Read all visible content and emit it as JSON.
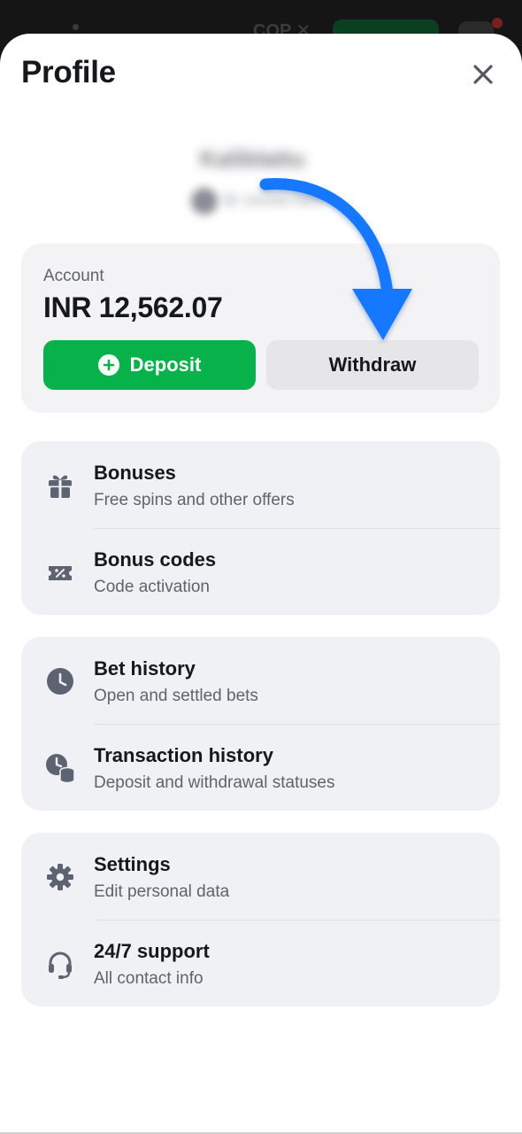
{
  "backdrop": {
    "currency": "COP ✕"
  },
  "profile": {
    "title": "Profile",
    "username": "Kaliblattu",
    "user_id": "ID 142567893"
  },
  "account": {
    "label": "Account",
    "balance": "INR 12,562.07",
    "deposit_label": "Deposit",
    "withdraw_label": "Withdraw"
  },
  "groups": [
    {
      "items": [
        {
          "icon": "gift-icon",
          "title": "Bonuses",
          "subtitle": "Free spins and other offers"
        },
        {
          "icon": "coupon-icon",
          "title": "Bonus codes",
          "subtitle": "Code activation"
        }
      ]
    },
    {
      "items": [
        {
          "icon": "clock-icon",
          "title": "Bet history",
          "subtitle": "Open and settled bets"
        },
        {
          "icon": "clock-coins-icon",
          "title": "Transaction history",
          "subtitle": "Deposit and withdrawal statuses"
        }
      ]
    },
    {
      "items": [
        {
          "icon": "gear-icon",
          "title": "Settings",
          "subtitle": "Edit personal data"
        },
        {
          "icon": "headset-icon",
          "title": "24/7 support",
          "subtitle": "All contact info"
        }
      ]
    }
  ],
  "colors": {
    "deposit": "#07b24b",
    "accent_arrow": "#1677ff",
    "icon": "#5d6370"
  }
}
